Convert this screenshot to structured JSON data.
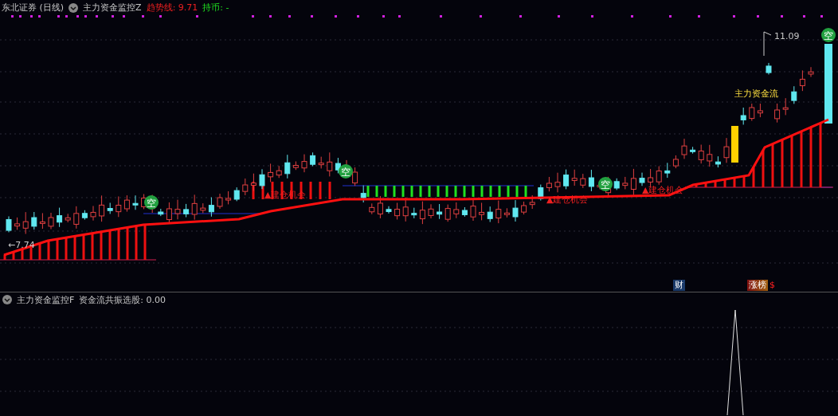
{
  "header": {
    "stock": "东北证券 (日线)",
    "indicator": "主力资金监控Z",
    "trend_label": "趋势线: 9.71",
    "hold_label": "持币: -"
  },
  "main_chart": {
    "low_price": "←7.74",
    "high_price": "11.09",
    "markers": [
      "空",
      "空",
      "空",
      "空"
    ],
    "signals": [
      "▲建仓机会",
      "▲建仓机会",
      "▲建仓机会"
    ],
    "flow_label": "主力资金流",
    "badges": [
      {
        "text": "财",
        "kind": "finance"
      },
      {
        "text": "涨榜",
        "kind": "rank"
      },
      {
        "text": "$",
        "kind": "dollar"
      }
    ]
  },
  "sub_panel": {
    "indicator": "主力资金监控F",
    "value_label": "资金流共振选股: 0.00"
  }
}
